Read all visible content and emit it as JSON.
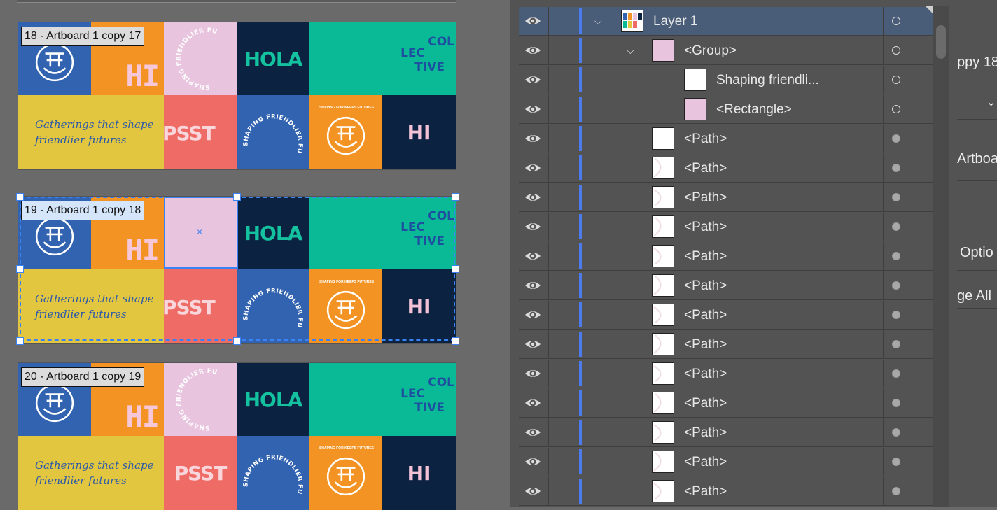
{
  "artboards": [
    {
      "label": "18 - Artboard 1 copy 17"
    },
    {
      "label": "19 - Artboard 1 copy 18"
    },
    {
      "label": "20 - Artboard 1 copy 19"
    }
  ],
  "artwork": {
    "hi": "HI",
    "hola": "HOLA",
    "psst": "PSST",
    "gather_line1": "Gatherings  that shape",
    "gather_line2": "friendlier futures",
    "col": "COL",
    "lec": "LEC",
    "tive": "TIVE",
    "arc_text": "SHAPING FRIENDLIER FUTURES",
    "arc_text_small": "SHAPING FOR KEEPS FUTURES"
  },
  "colors": {
    "blue": "#3263b0",
    "orange": "#f39323",
    "pink": "#e8c4de",
    "navy": "#0b2240",
    "teal": "#0ab995",
    "yellow": "#e2c640",
    "coral": "#ef6b65",
    "selection": "#3b82f6"
  },
  "layers": {
    "rows": [
      {
        "name": "Layer 1",
        "indent": 0,
        "expanded": true,
        "thumb": "layer",
        "target": "hollow"
      },
      {
        "name": "<Group>",
        "indent": 1,
        "expanded": true,
        "thumb": "pink",
        "target": "hollow"
      },
      {
        "name": "Shaping friendli...",
        "indent": 2,
        "thumb": "white",
        "target": "hollow"
      },
      {
        "name": "<Rectangle>",
        "indent": 2,
        "thumb": "pink",
        "target": "hollow"
      },
      {
        "name": "<Path>",
        "indent": 1,
        "thumb": "white",
        "target": "filled"
      },
      {
        "name": "<Path>",
        "indent": 1,
        "thumb": "white",
        "target": "filled"
      },
      {
        "name": "<Path>",
        "indent": 1,
        "thumb": "white",
        "target": "filled"
      },
      {
        "name": "<Path>",
        "indent": 1,
        "thumb": "white",
        "target": "filled"
      },
      {
        "name": "<Path>",
        "indent": 1,
        "thumb": "white",
        "target": "filled"
      },
      {
        "name": "<Path>",
        "indent": 1,
        "thumb": "white",
        "target": "filled"
      },
      {
        "name": "<Path>",
        "indent": 1,
        "thumb": "white",
        "target": "filled"
      },
      {
        "name": "<Path>",
        "indent": 1,
        "thumb": "white",
        "target": "filled"
      },
      {
        "name": "<Path>",
        "indent": 1,
        "thumb": "white",
        "target": "filled"
      },
      {
        "name": "<Path>",
        "indent": 1,
        "thumb": "white",
        "target": "filled"
      },
      {
        "name": "<Path>",
        "indent": 1,
        "thumb": "white",
        "target": "filled"
      },
      {
        "name": "<Path>",
        "indent": 1,
        "thumb": "white",
        "target": "filled"
      },
      {
        "name": "<Path>",
        "indent": 1,
        "thumb": "white",
        "target": "filled"
      }
    ]
  },
  "properties_panel": {
    "artboard_name_partial": "ppy 18",
    "section_partial": "Artboa",
    "options_partial": "Optio",
    "arrange_partial": "ge All"
  }
}
